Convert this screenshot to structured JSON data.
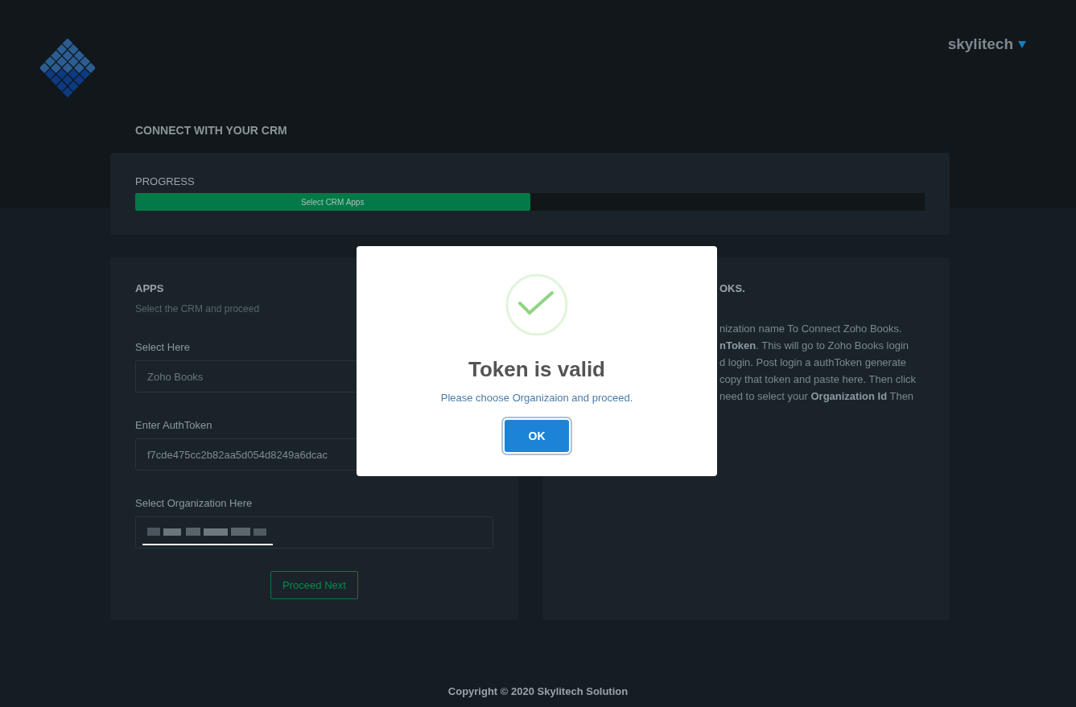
{
  "header": {
    "username": "skylitech"
  },
  "page_title": "CONNECT WITH YOUR CRM",
  "progress": {
    "label": "PROGRESS",
    "bar_text": "Select CRM Apps",
    "level": 0.5
  },
  "apps_panel": {
    "title": "APPS",
    "subtitle": "Select the CRM and proceed",
    "fields": [
      {
        "label": "Select Here",
        "placeholder": "Zoho Books"
      },
      {
        "label": "Enter AuthToken",
        "value": "f7cde475cc2b82aa5d054d8249a6dcac"
      },
      {
        "label": "Select Organization Here",
        "kind": "redacted"
      }
    ],
    "button": "Proceed Next"
  },
  "info_panel": {
    "title": "OKS.",
    "lines": [
      "nization name To Connect Zoho Books.",
      "**nToken**. This will go to Zoho Books login",
      "d login. Post login a authToken generate",
      "copy that token and paste here. Then click",
      "need to select your **Organization Id** Then"
    ]
  },
  "dialog": {
    "title": "Token is valid",
    "message": "Please choose Organizaion and proceed.",
    "button": "OK"
  },
  "footer": "Copyright © 2020 Skylitech Solution"
}
